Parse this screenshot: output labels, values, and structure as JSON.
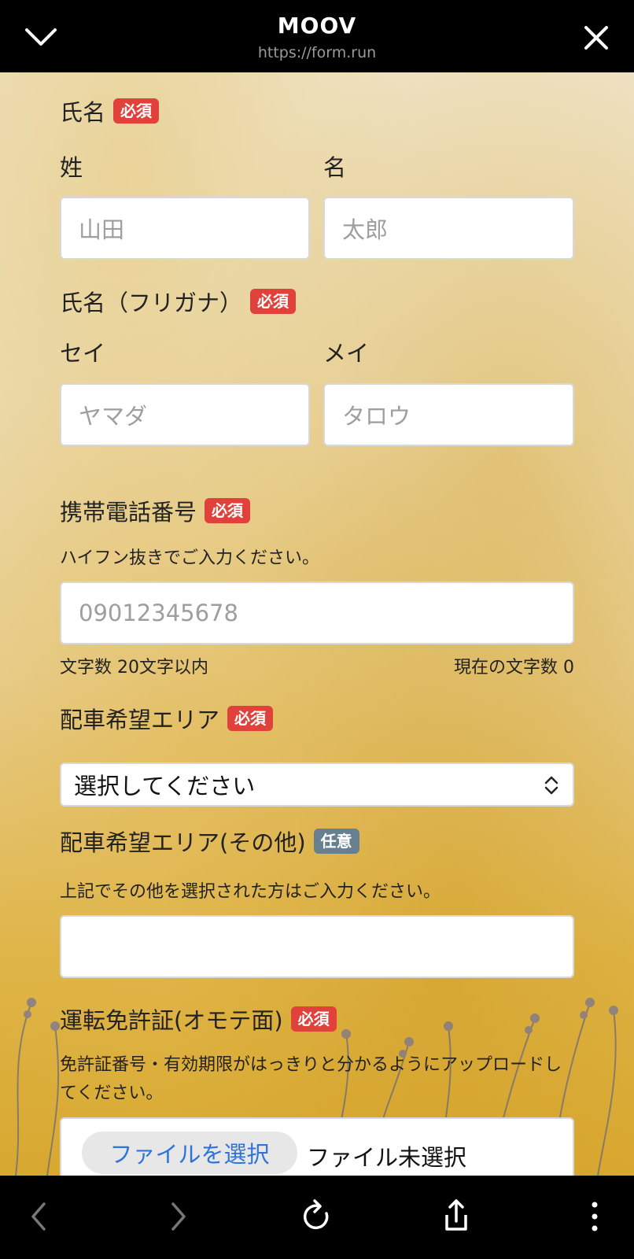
{
  "browser": {
    "title": "MOOV",
    "url": "https://form.run"
  },
  "form": {
    "name": {
      "label": "氏名",
      "badge": "必須",
      "last_label": "姓",
      "first_label": "名",
      "last_placeholder": "山田",
      "first_placeholder": "太郎"
    },
    "kana": {
      "label": "氏名（フリガナ）",
      "badge": "必須",
      "last_label": "セイ",
      "first_label": "メイ",
      "last_placeholder": "ヤマダ",
      "first_placeholder": "タロウ"
    },
    "phone": {
      "label": "携帯電話番号",
      "badge": "必須",
      "help": "ハイフン抜きでご入力ください。",
      "placeholder": "09012345678",
      "limit_text": "文字数 20文字以内",
      "count_text": "現在の文字数 0"
    },
    "area": {
      "label": "配車希望エリア",
      "badge": "必須",
      "selected": "選択してください"
    },
    "area_other": {
      "label": "配車希望エリア(その他)",
      "badge": "任意",
      "help": "上記でその他を選択された方はご入力ください。",
      "value": ""
    },
    "license": {
      "label": "運転免許証(オモテ面)",
      "badge": "必須",
      "help": "免許証番号・有効期限がはっきりと分かるようにアップロードしてください。",
      "button_label": "ファイルを選択",
      "status": "ファイル未選択"
    }
  },
  "icons": {
    "collapse": "chevron-down-icon",
    "close": "close-icon",
    "back": "back-arrow-icon",
    "forward": "forward-arrow-icon",
    "reload": "reload-icon",
    "share": "share-icon",
    "more": "more-vertical-icon"
  },
  "colors": {
    "required_badge": "#e0413b",
    "optional_badge": "#67808f",
    "link_blue": "#2f73d9"
  }
}
